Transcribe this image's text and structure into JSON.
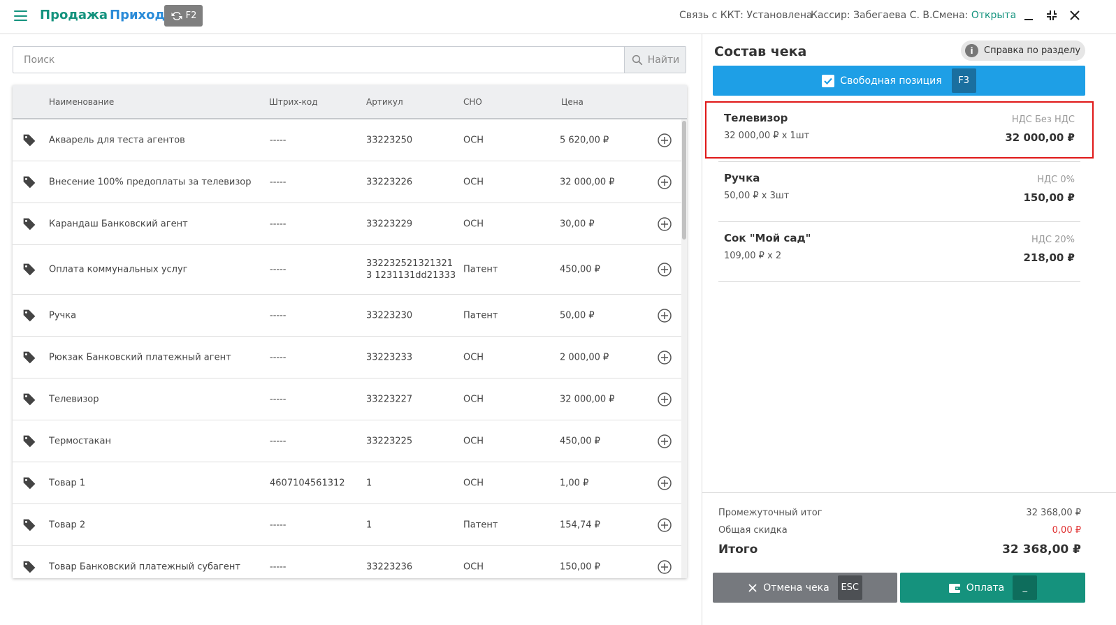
{
  "header": {
    "sale_title": "Продажа",
    "income_title": "Приход",
    "sync_key": "F2",
    "kkt_label": "Связь с ККТ:",
    "kkt_status": "Установлена",
    "cashier_label": "Кассир:",
    "cashier_name": "Забегаева С. В.",
    "shift_label": "Смена:",
    "shift_status": "Открыта"
  },
  "search": {
    "placeholder": "Поиск",
    "button_label": "Найти"
  },
  "table": {
    "columns": [
      "Наименование",
      "Штрих-код",
      "Артикул",
      "СНО",
      "Цена"
    ],
    "rows": [
      {
        "name": "Акварель для теста агентов",
        "barcode": "-----",
        "article": "33223250",
        "sno": "ОСН",
        "price": "5 620,00 ₽"
      },
      {
        "name": "Внесение 100% предоплаты за телевизор",
        "barcode": "-----",
        "article": "33223226",
        "sno": "ОСН",
        "price": "32 000,00 ₽"
      },
      {
        "name": "Карандаш Банковский агент",
        "barcode": "-----",
        "article": "33223229",
        "sno": "ОСН",
        "price": "30,00 ₽"
      },
      {
        "name": "Оплата коммунальных услуг",
        "barcode": "-----",
        "article": "3322325213213213 1231131dd21333",
        "sno": "Патент",
        "price": "450,00 ₽"
      },
      {
        "name": "Ручка",
        "barcode": "-----",
        "article": "33223230",
        "sno": "Патент",
        "price": "50,00 ₽"
      },
      {
        "name": "Рюкзак Банковский платежный агент",
        "barcode": "-----",
        "article": "33223233",
        "sno": "ОСН",
        "price": "2 000,00 ₽"
      },
      {
        "name": "Телевизор",
        "barcode": "-----",
        "article": "33223227",
        "sno": "ОСН",
        "price": "32 000,00 ₽"
      },
      {
        "name": "Термостакан",
        "barcode": "-----",
        "article": "33223225",
        "sno": "ОСН",
        "price": "450,00 ₽"
      },
      {
        "name": "Товар 1",
        "barcode": "4607104561312",
        "article": "1",
        "sno": "ОСН",
        "price": "1,00 ₽"
      },
      {
        "name": "Товар 2",
        "barcode": "-----",
        "article": "1",
        "sno": "Патент",
        "price": "154,74 ₽"
      },
      {
        "name": "Товар Банковский платежный субагент",
        "barcode": "-----",
        "article": "33223236",
        "sno": "ОСН",
        "price": "150,00 ₽"
      }
    ]
  },
  "receipt": {
    "title": "Состав чека",
    "help_label": "Справка по разделу",
    "free_position_label": "Свободная позиция",
    "free_position_key": "F3",
    "items": [
      {
        "name": "Телевизор",
        "qty": "32 000,00 ₽ x 1шт",
        "vat": "НДС Без НДС",
        "sum": "32 000,00 ₽"
      },
      {
        "name": "Ручка",
        "qty": "50,00 ₽ x 3шт",
        "vat": "НДС 0%",
        "sum": "150,00 ₽"
      },
      {
        "name": "Сок \"Мой сад\"",
        "qty": "109,00 ₽ x 2",
        "vat": "НДС 20%",
        "sum": "218,00 ₽"
      }
    ],
    "subtotal_label": "Промежуточный итог",
    "subtotal_value": "32 368,00 ₽",
    "discount_label": "Общая скидка",
    "discount_value": "0,00 ₽",
    "total_label": "Итого",
    "total_value": "32 368,00 ₽",
    "cancel_label": "Отмена чека",
    "cancel_key": "ESC",
    "pay_label": "Оплата",
    "pay_key": "_"
  },
  "colors": {
    "brand_green": "#14937e",
    "accent_blue": "#1e9fe6",
    "income_blue": "#2a8bd8",
    "discount_red": "#e03030",
    "highlight_red": "#e01818"
  }
}
